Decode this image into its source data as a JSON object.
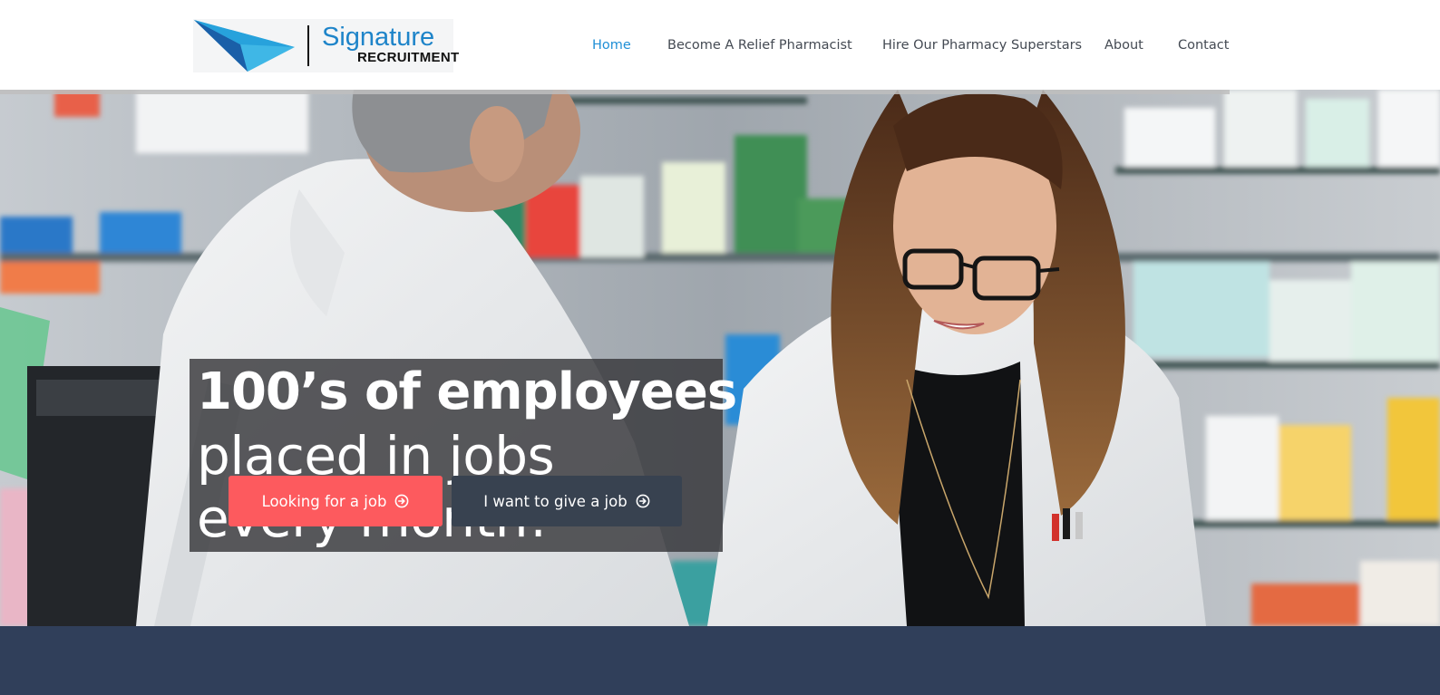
{
  "header": {
    "logo": {
      "wordmark": "Signature",
      "subtitle": "RECRUITMENT",
      "colors": {
        "wordmark": "#1e84c9",
        "arrow_light": "#3fb7e6",
        "arrow_dark": "#1a5fa8"
      }
    },
    "nav": [
      {
        "label": "Home",
        "active": true
      },
      {
        "label": "Become A Relief Pharmacist",
        "active": false
      },
      {
        "label": "Hire Our Pharmacy Superstars",
        "active": false
      },
      {
        "label": "About",
        "active": false
      },
      {
        "label": "Contact",
        "active": false
      }
    ],
    "colors": {
      "nav_text": "#444a53",
      "nav_active": "#1f8fd6"
    }
  },
  "hero": {
    "headline": {
      "strong": "100’s of employees",
      "line2": "placed in jobs",
      "line3": "every month!"
    },
    "buttons": [
      {
        "label": "Looking for a job",
        "icon": "arrow-right-circle-icon",
        "color": "#fd5a5e"
      },
      {
        "label": "I want to give a job",
        "icon": "arrow-right-circle-icon",
        "color": "#384250"
      }
    ],
    "image": {
      "description_icon": "pharmacy-photo"
    }
  },
  "footer_band": {
    "color": "#303f5a"
  }
}
